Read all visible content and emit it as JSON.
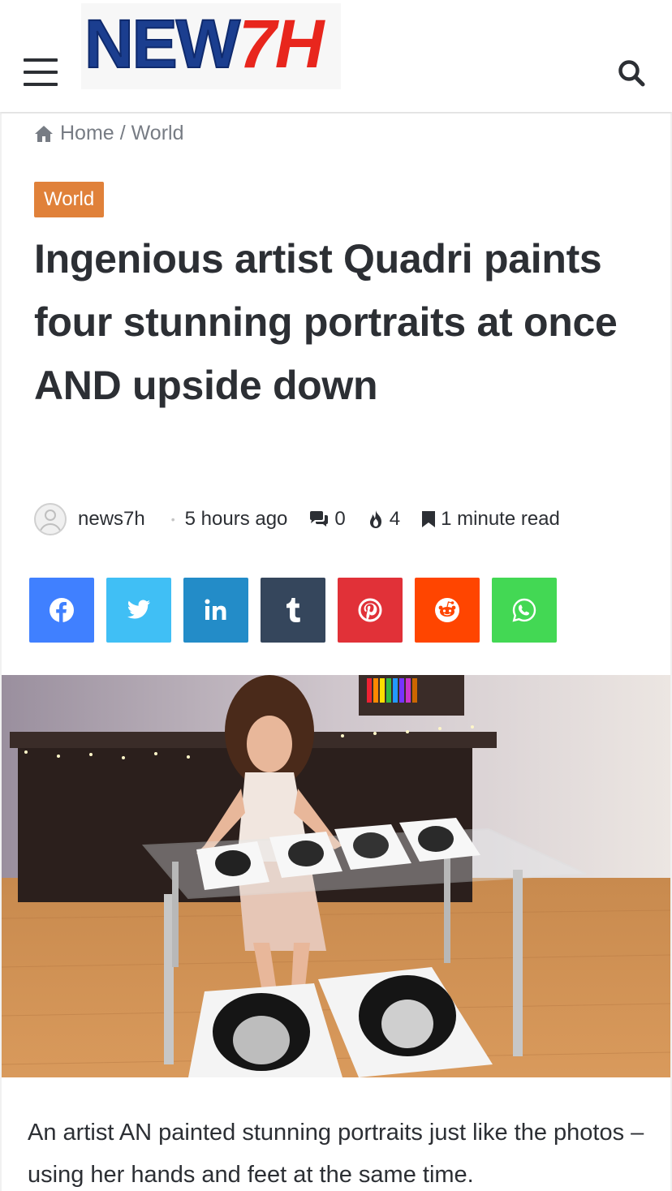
{
  "header": {
    "logo": {
      "part1": "NEW",
      "part2": "7H"
    },
    "menu_icon": "hamburger-icon",
    "search_icon": "search-icon"
  },
  "breadcrumb": {
    "home": "Home",
    "separator": "/",
    "current": "World"
  },
  "category": "World",
  "article": {
    "title": "Ingenious artist Quadri paints four stunning portraits at once AND upside down",
    "author": "news7h",
    "time_ago": "5 hours ago",
    "comments": "0",
    "views": "4",
    "read_time": "1 minute read",
    "lead": "An artist AN painted stunning portraits just like the photos – using her hands and feet at the same time."
  },
  "share": [
    {
      "name": "facebook",
      "color": "#4080ff"
    },
    {
      "name": "twitter",
      "color": "#40bff5"
    },
    {
      "name": "linkedin",
      "color": "#238cc8"
    },
    {
      "name": "tumblr",
      "color": "#35465c"
    },
    {
      "name": "pinterest",
      "color": "#e13138"
    },
    {
      "name": "reddit",
      "color": "#ff4500"
    },
    {
      "name": "whatsapp",
      "color": "#43d854"
    }
  ],
  "colors": {
    "accent": "#e0813a",
    "text": "#2c2f34",
    "muted": "#777c84"
  }
}
